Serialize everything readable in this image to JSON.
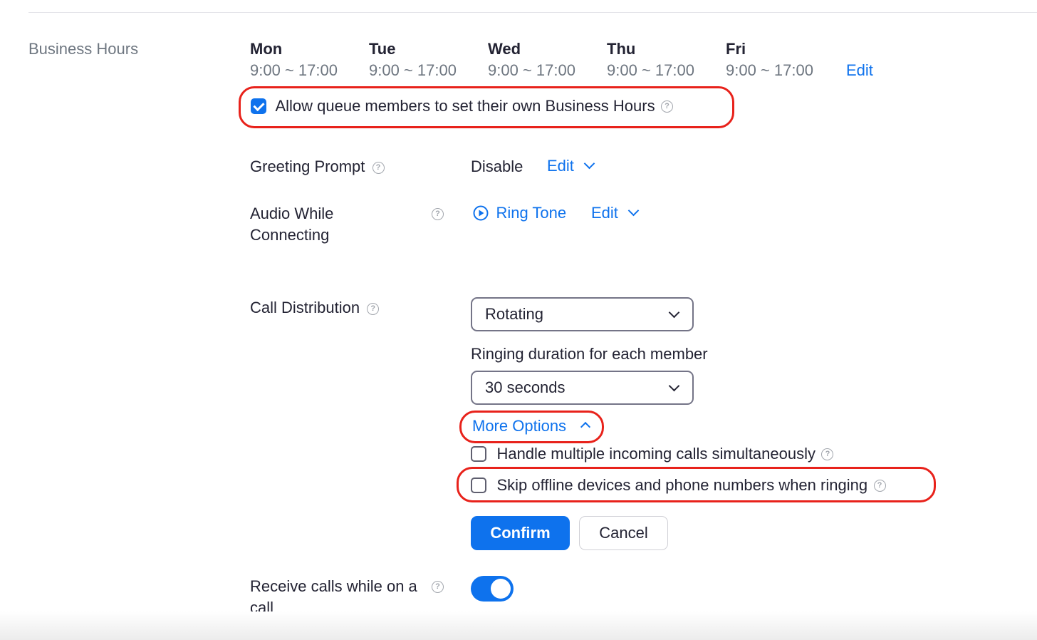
{
  "section": {
    "label": "Business Hours"
  },
  "business_hours": {
    "days": [
      {
        "name": "Mon",
        "hours": "9:00 ~ 17:00"
      },
      {
        "name": "Tue",
        "hours": "9:00 ~ 17:00"
      },
      {
        "name": "Wed",
        "hours": "9:00 ~ 17:00"
      },
      {
        "name": "Thu",
        "hours": "9:00 ~ 17:00"
      },
      {
        "name": "Fri",
        "hours": "9:00 ~ 17:00"
      }
    ],
    "edit_label": "Edit",
    "allow_own_hours": {
      "label": "Allow queue members to set their own Business Hours",
      "checked": true
    }
  },
  "greeting_prompt": {
    "label": "Greeting Prompt",
    "value": "Disable",
    "edit_label": "Edit"
  },
  "audio_while_connecting": {
    "label": "Audio While Connecting",
    "value": "Ring Tone",
    "edit_label": "Edit"
  },
  "call_distribution": {
    "label": "Call Distribution",
    "selected": "Rotating",
    "ringing_label": "Ringing duration for each member",
    "ringing_selected": "30 seconds",
    "more_options_label": "More Options",
    "options": [
      {
        "label": "Handle multiple incoming calls simultaneously",
        "checked": false
      },
      {
        "label": "Skip offline devices and phone numbers when ringing",
        "checked": false
      }
    ],
    "confirm_label": "Confirm",
    "cancel_label": "Cancel"
  },
  "receive_calls": {
    "label": "Receive calls while on a call",
    "enabled": true
  },
  "colors": {
    "accent": "#0e72ed",
    "highlight": "#e8221b",
    "muted": "#6e7680"
  }
}
